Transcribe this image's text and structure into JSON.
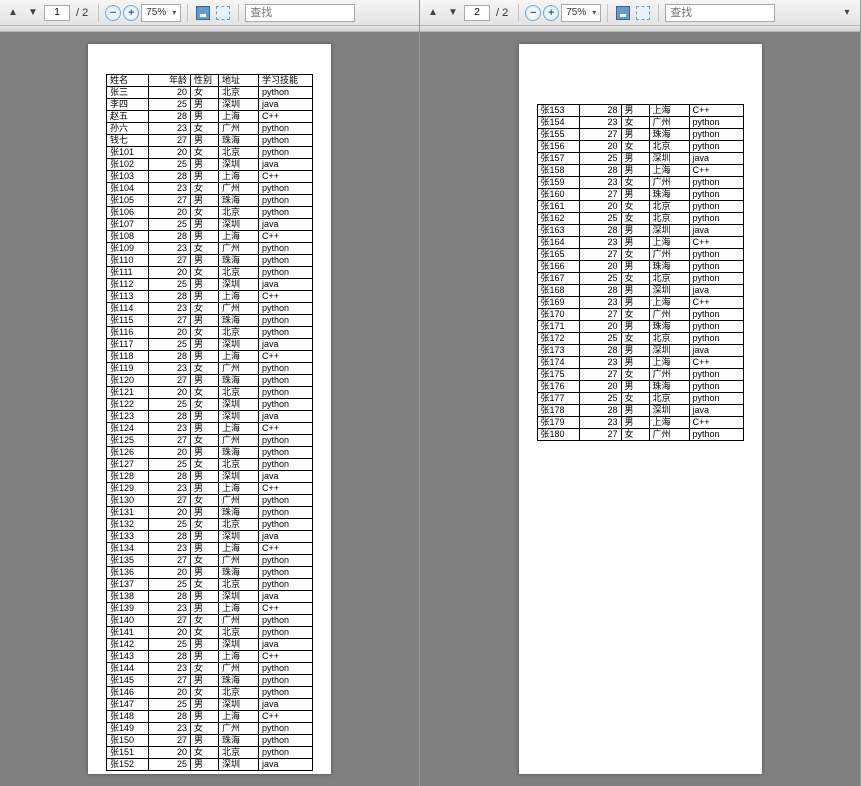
{
  "left": {
    "toolbar": {
      "page_current": "1",
      "page_total": "/ 2",
      "zoom": "75%",
      "search_placeholder": "查找"
    },
    "headers": [
      "姓名",
      "年龄",
      "性别",
      "地址",
      "学习技能"
    ],
    "rows": [
      [
        "张三",
        "20",
        "女",
        "北京",
        "python"
      ],
      [
        "李四",
        "25",
        "男",
        "深圳",
        "java"
      ],
      [
        "赵五",
        "28",
        "男",
        "上海",
        "C++"
      ],
      [
        "孙六",
        "23",
        "女",
        "广州",
        "python"
      ],
      [
        "钱七",
        "27",
        "男",
        "珠海",
        "python"
      ],
      [
        "张101",
        "20",
        "女",
        "北京",
        "python"
      ],
      [
        "张102",
        "25",
        "男",
        "深圳",
        "java"
      ],
      [
        "张103",
        "28",
        "男",
        "上海",
        "C++"
      ],
      [
        "张104",
        "23",
        "女",
        "广州",
        "python"
      ],
      [
        "张105",
        "27",
        "男",
        "珠海",
        "python"
      ],
      [
        "张106",
        "20",
        "女",
        "北京",
        "python"
      ],
      [
        "张107",
        "25",
        "男",
        "深圳",
        "java"
      ],
      [
        "张108",
        "28",
        "男",
        "上海",
        "C++"
      ],
      [
        "张109",
        "23",
        "女",
        "广州",
        "python"
      ],
      [
        "张110",
        "27",
        "男",
        "珠海",
        "python"
      ],
      [
        "张111",
        "20",
        "女",
        "北京",
        "python"
      ],
      [
        "张112",
        "25",
        "男",
        "深圳",
        "java"
      ],
      [
        "张113",
        "28",
        "男",
        "上海",
        "C++"
      ],
      [
        "张114",
        "23",
        "女",
        "广州",
        "python"
      ],
      [
        "张115",
        "27",
        "男",
        "珠海",
        "python"
      ],
      [
        "张116",
        "20",
        "女",
        "北京",
        "python"
      ],
      [
        "张117",
        "25",
        "男",
        "深圳",
        "java"
      ],
      [
        "张118",
        "28",
        "男",
        "上海",
        "C++"
      ],
      [
        "张119",
        "23",
        "女",
        "广州",
        "python"
      ],
      [
        "张120",
        "27",
        "男",
        "珠海",
        "python"
      ],
      [
        "张121",
        "20",
        "女",
        "北京",
        "python"
      ],
      [
        "张122",
        "25",
        "女",
        "深圳",
        "python"
      ],
      [
        "张123",
        "28",
        "男",
        "深圳",
        "java"
      ],
      [
        "张124",
        "23",
        "男",
        "上海",
        "C++"
      ],
      [
        "张125",
        "27",
        "女",
        "广州",
        "python"
      ],
      [
        "张126",
        "20",
        "男",
        "珠海",
        "python"
      ],
      [
        "张127",
        "25",
        "女",
        "北京",
        "python"
      ],
      [
        "张128",
        "28",
        "男",
        "深圳",
        "java"
      ],
      [
        "张129",
        "23",
        "男",
        "上海",
        "C++"
      ],
      [
        "张130",
        "27",
        "女",
        "广州",
        "python"
      ],
      [
        "张131",
        "20",
        "男",
        "珠海",
        "python"
      ],
      [
        "张132",
        "25",
        "女",
        "北京",
        "python"
      ],
      [
        "张133",
        "28",
        "男",
        "深圳",
        "java"
      ],
      [
        "张134",
        "23",
        "男",
        "上海",
        "C++"
      ],
      [
        "张135",
        "27",
        "女",
        "广州",
        "python"
      ],
      [
        "张136",
        "20",
        "男",
        "珠海",
        "python"
      ],
      [
        "张137",
        "25",
        "女",
        "北京",
        "python"
      ],
      [
        "张138",
        "28",
        "男",
        "深圳",
        "java"
      ],
      [
        "张139",
        "23",
        "男",
        "上海",
        "C++"
      ],
      [
        "张140",
        "27",
        "女",
        "广州",
        "python"
      ],
      [
        "张141",
        "20",
        "女",
        "北京",
        "python"
      ],
      [
        "张142",
        "25",
        "男",
        "深圳",
        "java"
      ],
      [
        "张143",
        "28",
        "男",
        "上海",
        "C++"
      ],
      [
        "张144",
        "23",
        "女",
        "广州",
        "python"
      ],
      [
        "张145",
        "27",
        "男",
        "珠海",
        "python"
      ],
      [
        "张146",
        "20",
        "女",
        "北京",
        "python"
      ],
      [
        "张147",
        "25",
        "男",
        "深圳",
        "java"
      ],
      [
        "张148",
        "28",
        "男",
        "上海",
        "C++"
      ],
      [
        "张149",
        "23",
        "女",
        "广州",
        "python"
      ],
      [
        "张150",
        "27",
        "男",
        "珠海",
        "python"
      ],
      [
        "张151",
        "20",
        "女",
        "北京",
        "python"
      ],
      [
        "张152",
        "25",
        "男",
        "深圳",
        "java"
      ]
    ]
  },
  "right": {
    "toolbar": {
      "page_current": "2",
      "page_total": "/ 2",
      "zoom": "75%",
      "search_placeholder": "查找"
    },
    "rows": [
      [
        "张153",
        "28",
        "男",
        "上海",
        "C++"
      ],
      [
        "张154",
        "23",
        "女",
        "广州",
        "python"
      ],
      [
        "张155",
        "27",
        "男",
        "珠海",
        "python"
      ],
      [
        "张156",
        "20",
        "女",
        "北京",
        "python"
      ],
      [
        "张157",
        "25",
        "男",
        "深圳",
        "java"
      ],
      [
        "张158",
        "28",
        "男",
        "上海",
        "C++"
      ],
      [
        "张159",
        "23",
        "女",
        "广州",
        "python"
      ],
      [
        "张160",
        "27",
        "男",
        "珠海",
        "python"
      ],
      [
        "张161",
        "20",
        "女",
        "北京",
        "python"
      ],
      [
        "张162",
        "25",
        "女",
        "北京",
        "python"
      ],
      [
        "张163",
        "28",
        "男",
        "深圳",
        "java"
      ],
      [
        "张164",
        "23",
        "男",
        "上海",
        "C++"
      ],
      [
        "张165",
        "27",
        "女",
        "广州",
        "python"
      ],
      [
        "张166",
        "20",
        "男",
        "珠海",
        "python"
      ],
      [
        "张167",
        "25",
        "女",
        "北京",
        "python"
      ],
      [
        "张168",
        "28",
        "男",
        "深圳",
        "java"
      ],
      [
        "张169",
        "23",
        "男",
        "上海",
        "C++"
      ],
      [
        "张170",
        "27",
        "女",
        "广州",
        "python"
      ],
      [
        "张171",
        "20",
        "男",
        "珠海",
        "python"
      ],
      [
        "张172",
        "25",
        "女",
        "北京",
        "python"
      ],
      [
        "张173",
        "28",
        "男",
        "深圳",
        "java"
      ],
      [
        "张174",
        "23",
        "男",
        "上海",
        "C++"
      ],
      [
        "张175",
        "27",
        "女",
        "广州",
        "python"
      ],
      [
        "张176",
        "20",
        "男",
        "珠海",
        "python"
      ],
      [
        "张177",
        "25",
        "女",
        "北京",
        "python"
      ],
      [
        "张178",
        "28",
        "男",
        "深圳",
        "java"
      ],
      [
        "张179",
        "23",
        "男",
        "上海",
        "C++"
      ],
      [
        "张180",
        "27",
        "女",
        "广州",
        "python"
      ]
    ]
  }
}
